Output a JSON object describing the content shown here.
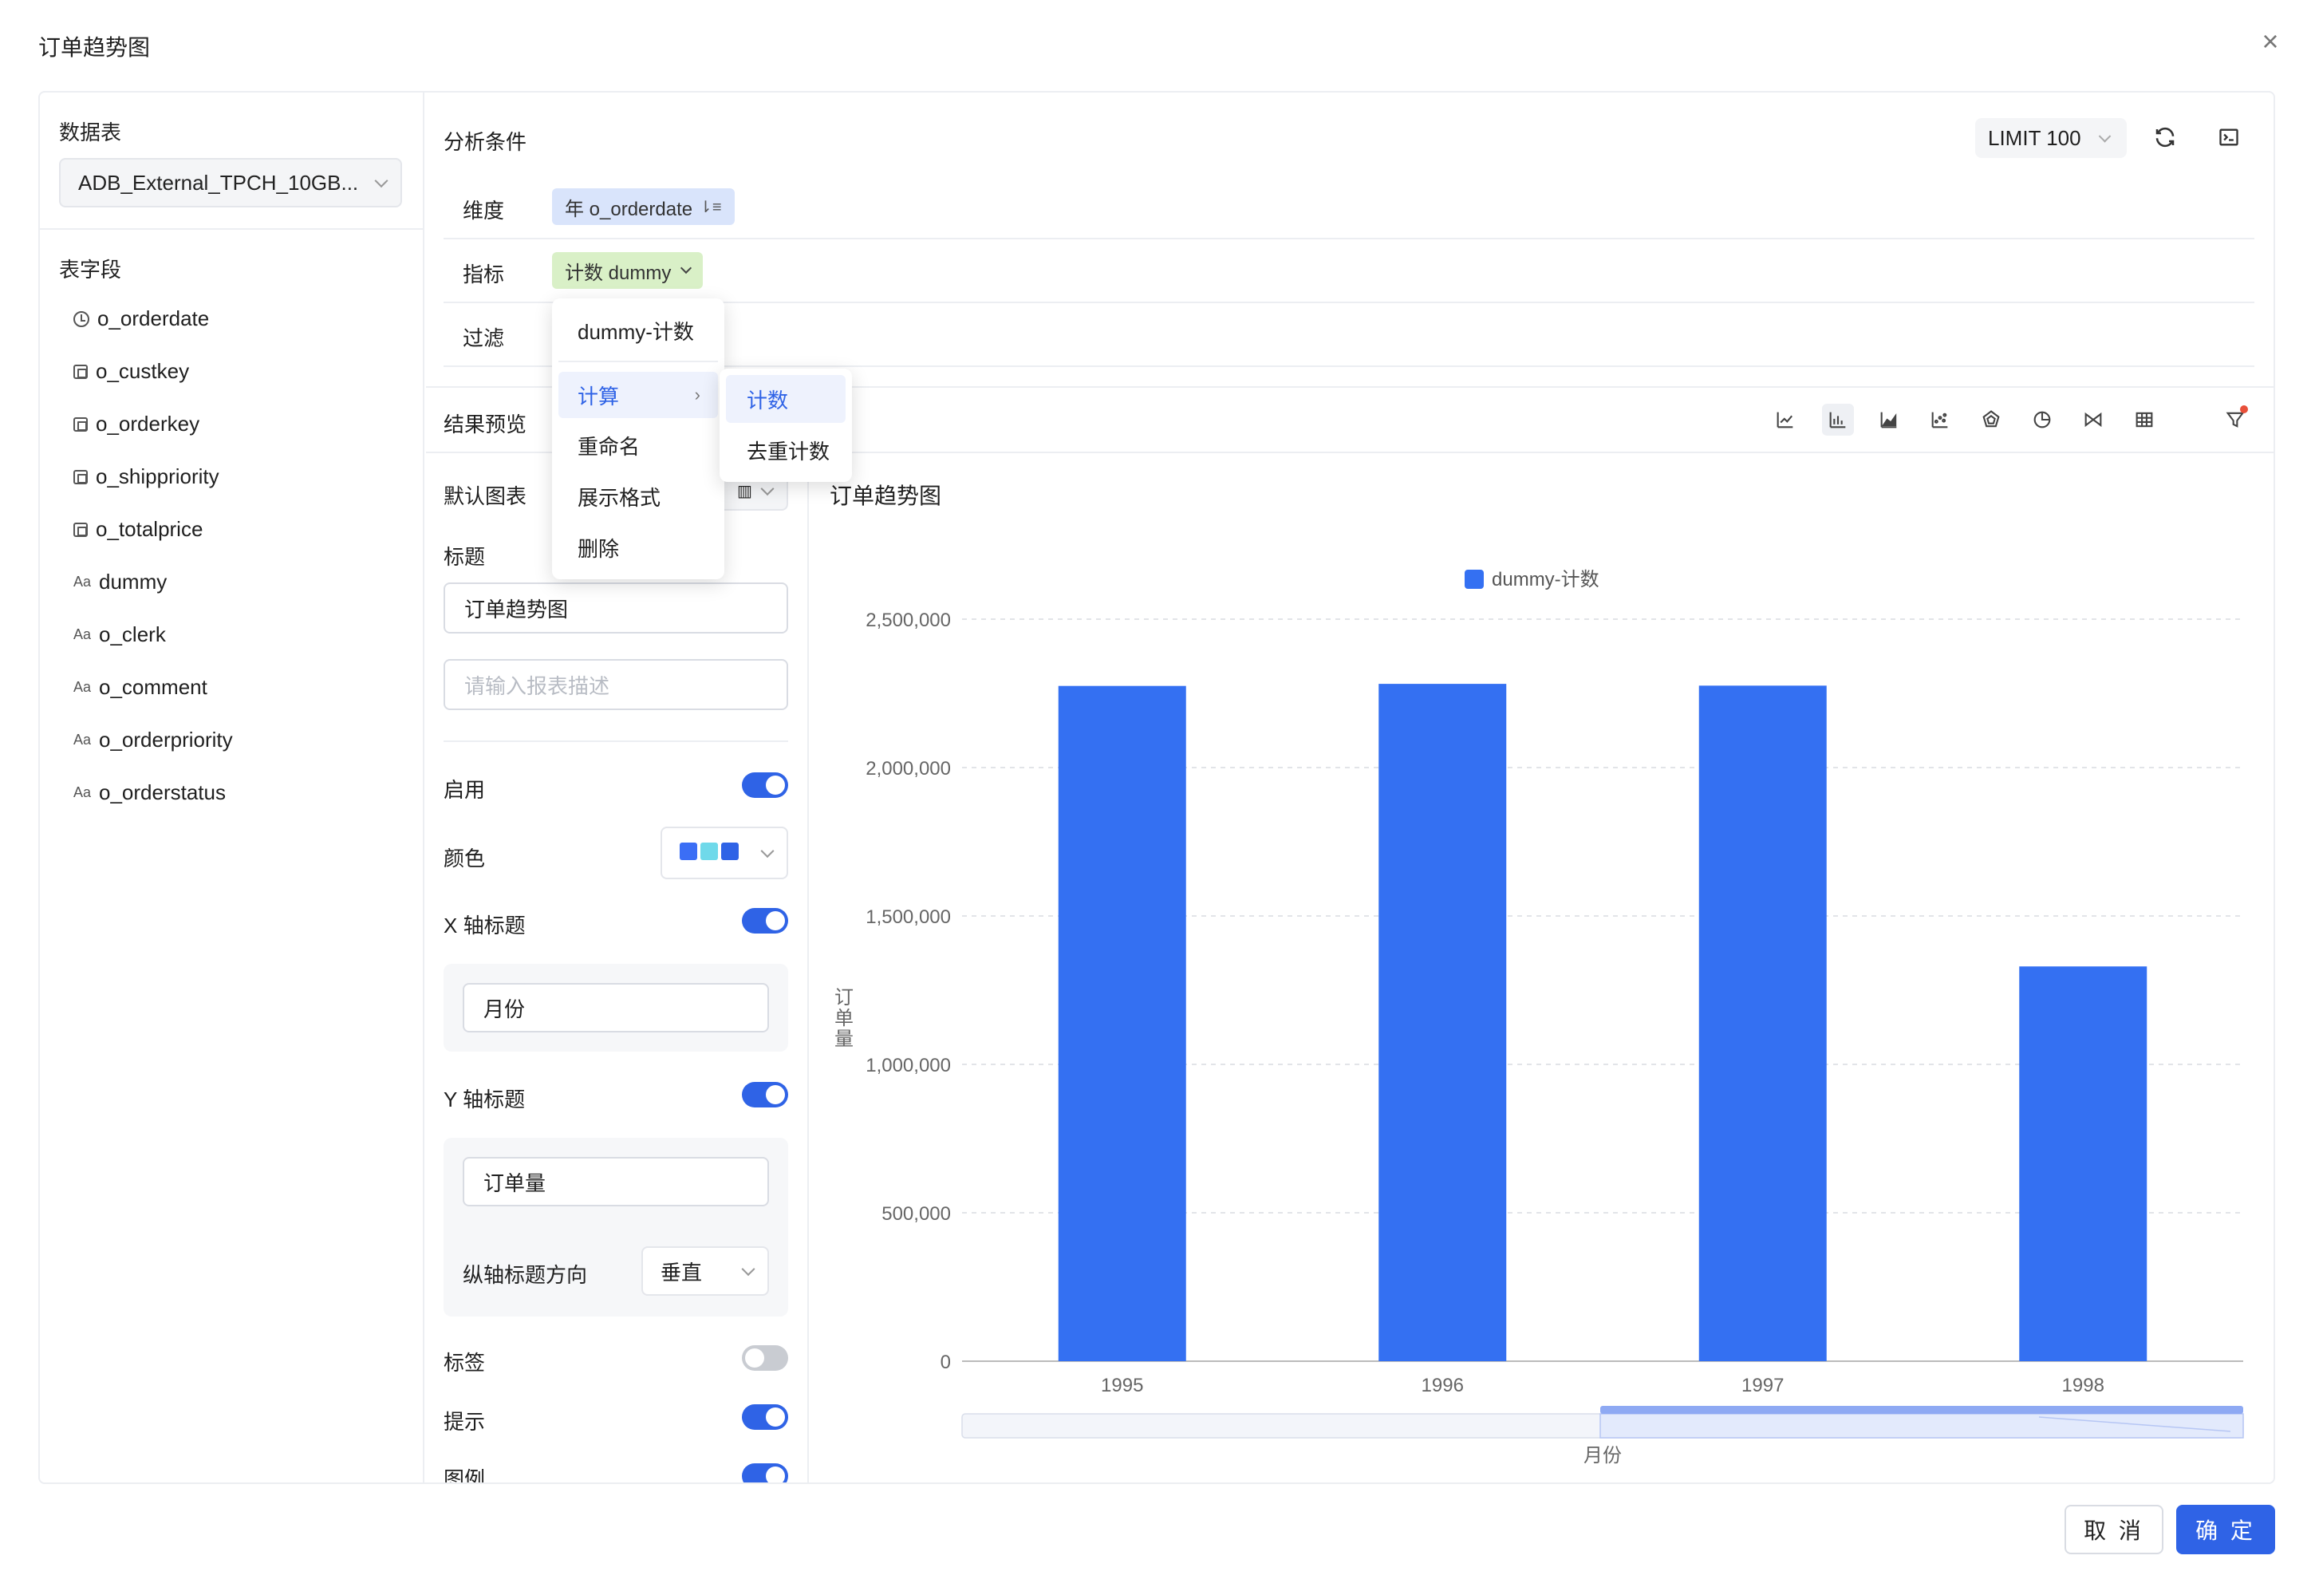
{
  "modal": {
    "title": "订单趋势图"
  },
  "left": {
    "table_label": "数据表",
    "table_value": "ADB_External_TPCH_10GB...",
    "fields_label": "表字段",
    "fields": [
      {
        "name": "o_orderdate",
        "icon": "clock-icon"
      },
      {
        "name": "o_custkey",
        "icon": "number-icon"
      },
      {
        "name": "o_orderkey",
        "icon": "number-icon"
      },
      {
        "name": "o_shippriority",
        "icon": "number-icon"
      },
      {
        "name": "o_totalprice",
        "icon": "number-icon"
      },
      {
        "name": "dummy",
        "icon": "text-icon"
      },
      {
        "name": "o_clerk",
        "icon": "text-icon"
      },
      {
        "name": "o_comment",
        "icon": "text-icon"
      },
      {
        "name": "o_orderpriority",
        "icon": "text-icon"
      },
      {
        "name": "o_orderstatus",
        "icon": "text-icon"
      }
    ],
    "text_icon_glyph": "Aa"
  },
  "conditions": {
    "title": "分析条件",
    "limit": "LIMIT 100",
    "dimension_label": "维度",
    "dimension_chip": "年 o_orderdate",
    "metric_label": "指标",
    "metric_chip": "计数 dummy",
    "filter_label": "过滤"
  },
  "menu": {
    "items": [
      "dummy-计数",
      "计算",
      "重命名",
      "展示格式",
      "删除"
    ],
    "submenu": [
      "计数",
      "去重计数"
    ]
  },
  "preview": {
    "title": "结果预览"
  },
  "config": {
    "default_chart_label": "默认图表",
    "title_label": "标题",
    "title_value": "订单趋势图",
    "desc_placeholder": "请输入报表描述",
    "enable_label": "启用",
    "color_label": "颜色",
    "x_title_label": "X 轴标题",
    "x_title_value": "月份",
    "y_title_label": "Y 轴标题",
    "y_title_value": "订单量",
    "y_dir_label": "纵轴标题方向",
    "y_dir_value": "垂直",
    "tag_label": "标签",
    "tip_label": "提示",
    "legend_label": "图例",
    "toggles": {
      "enable": true,
      "x_title": true,
      "y_title": true,
      "tag": false,
      "tip": true,
      "legend": true
    },
    "palette": [
      "#3b6ef5",
      "#6fd9ea",
      "#2f63e6"
    ]
  },
  "footer": {
    "cancel": "取 消",
    "ok": "确 定"
  },
  "colors": {
    "accent": "#2f63e6",
    "bar": "#3470f2"
  },
  "chart_data": {
    "type": "bar",
    "title": "订单趋势图",
    "categories": [
      "1995",
      "1996",
      "1997",
      "1998"
    ],
    "series": [
      {
        "name": "dummy-计数",
        "values": [
          2275000,
          2282000,
          2276000,
          1330000
        ]
      }
    ],
    "xlabel": "月份",
    "ylabel": "订单量",
    "ylim": [
      0,
      2500000
    ],
    "yticks": [
      "0",
      "500,000",
      "1,000,000",
      "1,500,000",
      "2,000,000",
      "2,500,000"
    ],
    "grid": true,
    "legend": "top-center"
  }
}
